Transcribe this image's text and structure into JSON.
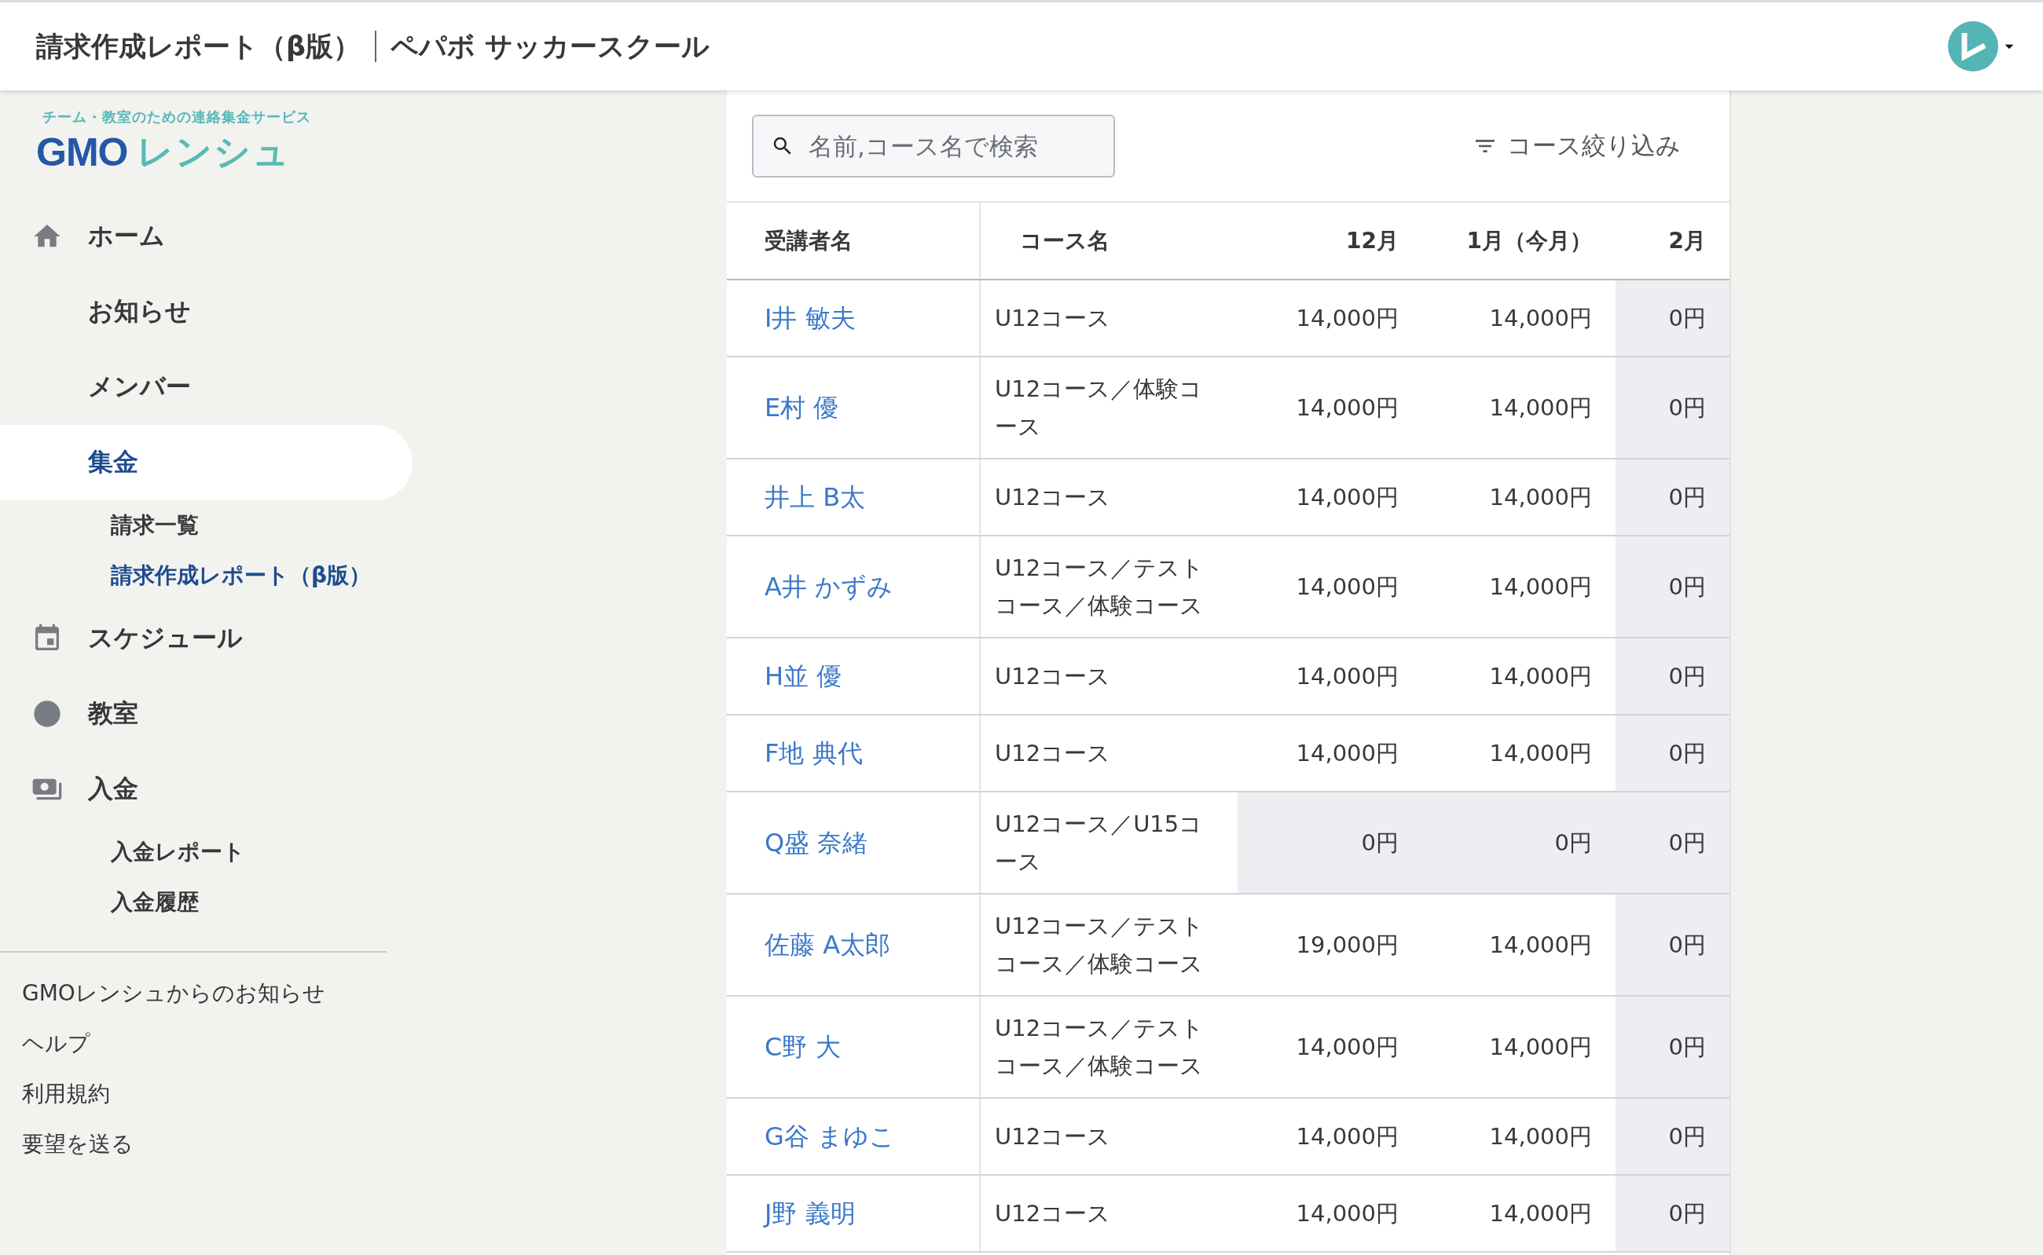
{
  "header": {
    "page_title": "請求作成レポート（β版）",
    "team_name": "ペパボ サッカースクール"
  },
  "logo": {
    "tagline": "チーム・教室のための連絡集金サービス",
    "brand": "GMO",
    "product": "レンシュ"
  },
  "sidebar": {
    "items": [
      {
        "label": "ホーム",
        "kind": "home",
        "selected": false
      },
      {
        "label": "お知らせ",
        "kind": "plain",
        "selected": false
      },
      {
        "label": "メンバー",
        "kind": "plain",
        "selected": false
      },
      {
        "label": "集金",
        "kind": "plain",
        "selected": true,
        "children": [
          {
            "label": "請求一覧",
            "selected": false
          },
          {
            "label": "請求作成レポート（β版）",
            "selected": true
          }
        ]
      },
      {
        "label": "スケジュール",
        "kind": "calendar",
        "selected": false
      },
      {
        "label": "教室",
        "kind": "classroom",
        "selected": false
      },
      {
        "label": "入金",
        "kind": "payment",
        "selected": false,
        "children": [
          {
            "label": "入金レポート",
            "selected": false
          },
          {
            "label": "入金履歴",
            "selected": false
          }
        ]
      }
    ],
    "footer_links": [
      "GMOレンシュからのお知らせ",
      "ヘルプ",
      "利用規約",
      "要望を送る"
    ]
  },
  "search": {
    "placeholder": "名前,コース名で検索"
  },
  "filter": {
    "label": "コース絞り込み"
  },
  "table": {
    "columns": [
      "受講者名",
      "コース名",
      "12月",
      "1月（今月）",
      "2月"
    ],
    "rows": [
      {
        "name": "I井 敏夫",
        "course": "U12コース",
        "amounts": [
          {
            "text": "14,000円",
            "shaded": false
          },
          {
            "text": "14,000円",
            "shaded": false
          },
          {
            "text": "0円",
            "shaded": true
          }
        ]
      },
      {
        "name": "E村 優",
        "course": "U12コース／体験コース",
        "amounts": [
          {
            "text": "14,000円",
            "shaded": false
          },
          {
            "text": "14,000円",
            "shaded": false
          },
          {
            "text": "0円",
            "shaded": true
          }
        ]
      },
      {
        "name": "井上 B太",
        "course": "U12コース",
        "amounts": [
          {
            "text": "14,000円",
            "shaded": false
          },
          {
            "text": "14,000円",
            "shaded": false
          },
          {
            "text": "0円",
            "shaded": true
          }
        ]
      },
      {
        "name": "A井 かずみ",
        "course": "U12コース／テストコース／体験コース",
        "amounts": [
          {
            "text": "14,000円",
            "shaded": false
          },
          {
            "text": "14,000円",
            "shaded": false
          },
          {
            "text": "0円",
            "shaded": true
          }
        ]
      },
      {
        "name": "H並 優",
        "course": "U12コース",
        "amounts": [
          {
            "text": "14,000円",
            "shaded": false
          },
          {
            "text": "14,000円",
            "shaded": false
          },
          {
            "text": "0円",
            "shaded": true
          }
        ]
      },
      {
        "name": "F地 典代",
        "course": "U12コース",
        "amounts": [
          {
            "text": "14,000円",
            "shaded": false
          },
          {
            "text": "14,000円",
            "shaded": false
          },
          {
            "text": "0円",
            "shaded": true
          }
        ]
      },
      {
        "name": "Q盛 奈緒",
        "course": "U12コース／U15コース",
        "amounts": [
          {
            "text": "0円",
            "shaded": true
          },
          {
            "text": "0円",
            "shaded": true
          },
          {
            "text": "0円",
            "shaded": true
          }
        ]
      },
      {
        "name": "佐藤 A太郎",
        "course": "U12コース／テストコース／体験コース",
        "amounts": [
          {
            "text": "19,000円",
            "shaded": false
          },
          {
            "text": "14,000円",
            "shaded": false
          },
          {
            "text": "0円",
            "shaded": true
          }
        ]
      },
      {
        "name": "C野 大",
        "course": "U12コース／テストコース／体験コース",
        "amounts": [
          {
            "text": "14,000円",
            "shaded": false
          },
          {
            "text": "14,000円",
            "shaded": false
          },
          {
            "text": "0円",
            "shaded": true
          }
        ]
      },
      {
        "name": "G谷 まゆこ",
        "course": "U12コース",
        "amounts": [
          {
            "text": "14,000円",
            "shaded": false
          },
          {
            "text": "14,000円",
            "shaded": false
          },
          {
            "text": "0円",
            "shaded": true
          }
        ]
      },
      {
        "name": "J野 義明",
        "course": "U12コース",
        "amounts": [
          {
            "text": "14,000円",
            "shaded": false
          },
          {
            "text": "14,000円",
            "shaded": false
          },
          {
            "text": "0円",
            "shaded": true
          }
        ]
      }
    ]
  }
}
